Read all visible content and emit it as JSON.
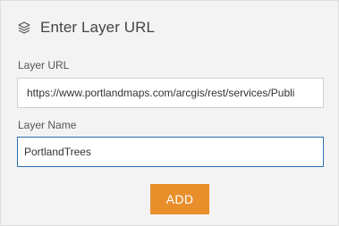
{
  "dialog": {
    "icon": "layers-icon",
    "title": "Enter Layer URL"
  },
  "form": {
    "url_label": "Layer URL",
    "url_value": "https://www.portlandmaps.com/arcgis/rest/services/Publi",
    "name_label": "Layer Name",
    "name_value": "PortlandTrees",
    "add_label": "ADD"
  },
  "colors": {
    "panel_background": "#f3f3f3",
    "focus_border": "#2b6fae",
    "accent_button": "#e88f2c"
  }
}
